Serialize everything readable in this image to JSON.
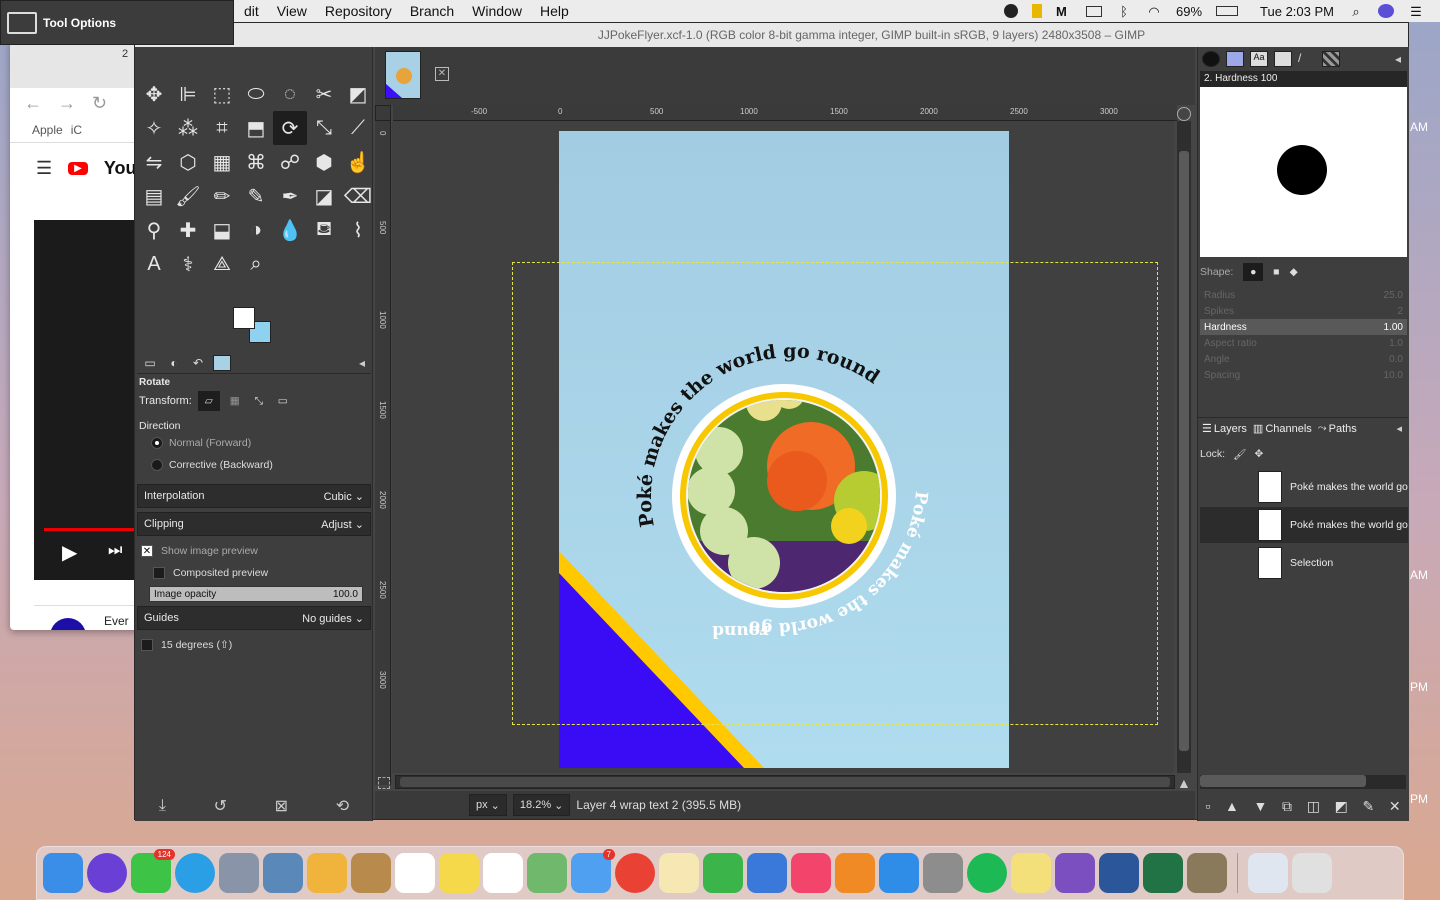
{
  "menubar": {
    "items": [
      "dit",
      "View",
      "Repository",
      "Branch",
      "Window",
      "Help"
    ],
    "battery": "69%",
    "clock": "Tue 2:03 PM"
  },
  "tool_options_tab": {
    "label": "Tool Options"
  },
  "browser": {
    "tab_text": "2",
    "bookmarks": [
      "Apple",
      "iC"
    ],
    "youtube": "You",
    "bottom_text": "Ever"
  },
  "gimp": {
    "title": "JJPokeFlyer.xcf-1.0 (RGB color 8-bit gamma integer, GIMP built-in sRGB, 9 layers) 2480x3508 – GIMP",
    "tools": [
      "move-icon",
      "align-icon",
      "rect-select-icon",
      "ellipse-select-icon",
      "free-select-icon",
      "scissors-icon",
      "fg-select-icon",
      "fuzzy-select-icon",
      "color-select-icon",
      "crop-icon",
      "unified-transform-icon",
      "rotate-icon",
      "scale-icon",
      "shear-icon",
      "flip-icon",
      "perspective-icon",
      "cage-icon",
      "warp-icon",
      "handle-transform-icon",
      "3d-transform-icon",
      "smudge-icon",
      "gradient-icon",
      "paintbrush-icon",
      "pencil-icon",
      "airbrush-icon",
      "ink-icon",
      "mypaint-icon",
      "eraser-icon",
      "clone-icon",
      "heal-icon",
      "perspective-clone-icon",
      "dodge-icon",
      "blur-icon",
      "bucket-icon",
      "paths-icon",
      "text-icon",
      "color-picker-icon",
      "measure-icon",
      "zoom-icon"
    ],
    "options": {
      "title": "Rotate",
      "transform_label": "Transform:",
      "direction_label": "Direction",
      "direction_normal": "Normal (Forward)",
      "direction_corrective": "Corrective (Backward)",
      "interpolation_label": "Interpolation",
      "interpolation_value": "Cubic",
      "clipping_label": "Clipping",
      "clipping_value": "Adjust",
      "show_preview": "Show image preview",
      "composited_preview": "Composited preview",
      "opacity_label": "Image opacity",
      "opacity_value": "100.0",
      "guides_label": "Guides",
      "guides_value": "No guides",
      "degrees_label": "15 degrees (⇧)"
    },
    "ruler_labels": [
      "-500",
      "0",
      "500",
      "1000",
      "1500",
      "2000",
      "2500",
      "3000"
    ],
    "ruler_v_labels": [
      "0",
      "500",
      "1000",
      "1500",
      "2000",
      "2500",
      "3000"
    ],
    "status": {
      "unit": "px",
      "zoom": "18.2%",
      "message": "Layer 4 wrap text 2 (395.5 MB)"
    },
    "flyer": {
      "top_text": "Poké makes the world go round",
      "right_text": "Poké makes the world go",
      "bottom_text": "round"
    },
    "brush": {
      "name": "2. Hardness 100",
      "shape_label": "Shape:",
      "props": [
        {
          "name": "Radius",
          "value": "25.0"
        },
        {
          "name": "Spikes",
          "value": "2"
        },
        {
          "name": "Hardness",
          "value": "1.00"
        },
        {
          "name": "Aspect ratio",
          "value": "1.0"
        },
        {
          "name": "Angle",
          "value": "0.0"
        },
        {
          "name": "Spacing",
          "value": "10.0"
        }
      ]
    },
    "layers": {
      "tabs": [
        "Layers",
        "Channels",
        "Paths"
      ],
      "lock_label": "Lock:",
      "rows": [
        "Poké makes the world go",
        "Poké makes the world go",
        "Selection"
      ]
    }
  },
  "dock_right_clock": [
    "AM",
    "AM",
    "PM",
    "PM"
  ],
  "dock_apps": [
    {
      "name": "finder",
      "color": "#3a8ee8"
    },
    {
      "name": "siri",
      "color": "#6a3fd6"
    },
    {
      "name": "facetime",
      "color": "#3dc447",
      "badge": "124"
    },
    {
      "name": "safari",
      "color": "#2a9fe6"
    },
    {
      "name": "launchpad",
      "color": "#8a94a8"
    },
    {
      "name": "preview",
      "color": "#5a88b8"
    },
    {
      "name": "photos",
      "color": "#f0b43c"
    },
    {
      "name": "contacts",
      "color": "#b88a4c"
    },
    {
      "name": "calendar",
      "color": "#ffffff"
    },
    {
      "name": "notes",
      "color": "#f6d94a"
    },
    {
      "name": "reminders",
      "color": "#ffffff"
    },
    {
      "name": "maps",
      "color": "#70b86c"
    },
    {
      "name": "messages",
      "color": "#4fa0f0",
      "badge": "7"
    },
    {
      "name": "chrome",
      "color": "#e94235"
    },
    {
      "name": "textedit",
      "color": "#f7e7b2"
    },
    {
      "name": "numbers",
      "color": "#3bb54a"
    },
    {
      "name": "keynote",
      "color": "#3a79d9"
    },
    {
      "name": "itunes",
      "color": "#f3456c"
    },
    {
      "name": "books",
      "color": "#f08a24"
    },
    {
      "name": "appstore",
      "color": "#2f8de8"
    },
    {
      "name": "system-preferences",
      "color": "#8d8d8d"
    },
    {
      "name": "spotify",
      "color": "#1db954"
    },
    {
      "name": "stickies",
      "color": "#f4e07a"
    },
    {
      "name": "github",
      "color": "#7b4fbf"
    },
    {
      "name": "word",
      "color": "#2b579a"
    },
    {
      "name": "excel",
      "color": "#217346"
    },
    {
      "name": "gimp",
      "color": "#8a7a5c"
    },
    {
      "name": "downloads",
      "color": "#dfe6f0"
    },
    {
      "name": "trash",
      "color": "#e0e0e0"
    }
  ]
}
